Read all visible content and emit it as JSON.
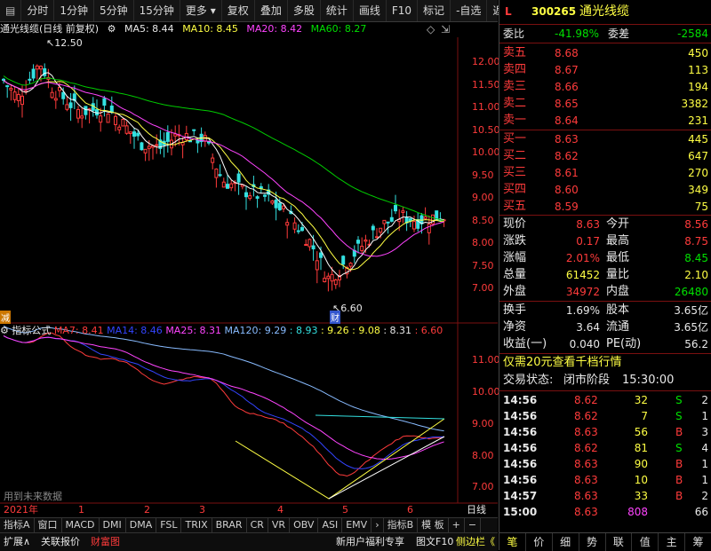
{
  "toolbar": {
    "left_items": [
      "分时",
      "1分钟",
      "5分钟",
      "15分钟",
      "更多"
    ],
    "right_items": [
      "复权",
      "叠加",
      "多股",
      "统计",
      "画线",
      "F10",
      "标记",
      "-自选",
      "返回"
    ]
  },
  "chart_header": {
    "title": "通光线缆(日线 前复权)",
    "ma5": "MA5: 8.44",
    "ma10": "MA10: 8.45",
    "ma20": "MA20: 8.42",
    "ma60": "MA60: 8.27"
  },
  "price_axis": [
    "12.00",
    "11.50",
    "11.00",
    "10.50",
    "10.00",
    "9.50",
    "9.00",
    "8.50",
    "8.00",
    "7.50",
    "7.00"
  ],
  "annotations": {
    "high_label": "12.50",
    "low_label": "6.60",
    "left_marker": "减",
    "caifu_marker": "财"
  },
  "indicator_header": {
    "name": "指标公式",
    "ma7": "MA7: 8.41",
    "ma14": "MA14: 8.46",
    "ma25": "MA25: 8.31",
    "ma120": "MA120: 9.29",
    "v1": ": 8.93",
    "v2": ": 9.26",
    "v3": ": 9.08",
    "v4": ": 8.31",
    "v5": ": 6.60"
  },
  "indicator_axis": [
    "11.00",
    "10.00",
    "9.00",
    "8.00",
    "7.00"
  ],
  "indicator_note": "用到未来数据",
  "date_axis": {
    "year": "2021年",
    "months": [
      "1",
      "2",
      "3",
      "4",
      "5",
      "6"
    ],
    "period": "日线"
  },
  "indicator_tabs": [
    "指标A",
    "窗口",
    "MACD",
    "DMI",
    "DMA",
    "FSL",
    "TRIX",
    "BRAR",
    "CR",
    "VR",
    "OBV",
    "ASI",
    "EMV",
    "指标B",
    "模 板",
    "+",
    "−"
  ],
  "bottom_left": [
    "扩展∧",
    "关联报价",
    "财富图"
  ],
  "bottom_right": [
    "新用户福利专享",
    "图文F10",
    "侧边栏《"
  ],
  "stock": {
    "flag": "L",
    "code": "300265",
    "name": "通光线缆"
  },
  "weibi": {
    "label1": "委比",
    "val1": "-41.98%",
    "label2": "委差",
    "val2": "-2584"
  },
  "sells": [
    {
      "label": "卖五",
      "price": "8.68",
      "vol": "450"
    },
    {
      "label": "卖四",
      "price": "8.67",
      "vol": "113"
    },
    {
      "label": "卖三",
      "price": "8.66",
      "vol": "194"
    },
    {
      "label": "卖二",
      "price": "8.65",
      "vol": "3382"
    },
    {
      "label": "卖一",
      "price": "8.64",
      "vol": "231"
    }
  ],
  "buys": [
    {
      "label": "买一",
      "price": "8.63",
      "vol": "445"
    },
    {
      "label": "买二",
      "price": "8.62",
      "vol": "647"
    },
    {
      "label": "买三",
      "price": "8.61",
      "vol": "270"
    },
    {
      "label": "买四",
      "price": "8.60",
      "vol": "349"
    },
    {
      "label": "买五",
      "price": "8.59",
      "vol": "75"
    }
  ],
  "quote": [
    {
      "l1": "现价",
      "v1": "8.63",
      "l2": "今开",
      "v2": "8.56"
    },
    {
      "l1": "涨跌",
      "v1": "0.17",
      "l2": "最高",
      "v2": "8.75"
    },
    {
      "l1": "涨幅",
      "v1": "2.01%",
      "l2": "最低",
      "v2": "8.45"
    },
    {
      "l1": "总量",
      "v1": "61452",
      "l2": "量比",
      "v2": "2.10"
    },
    {
      "l1": "外盘",
      "v1": "34972",
      "l2": "内盘",
      "v2": "26480"
    }
  ],
  "stats": [
    {
      "l1": "换手",
      "v1": "1.69%",
      "l2": "股本",
      "v2": "3.65亿"
    },
    {
      "l1": "净资",
      "v1": "3.64",
      "l2": "流通",
      "v2": "3.65亿"
    },
    {
      "l1": "收益(一)",
      "v1": "0.040",
      "l2": "PE(动)",
      "v2": "56.2"
    }
  ],
  "promo": "仅需20元查看千档行情",
  "status": {
    "label": "交易状态:",
    "value": "闭市阶段",
    "time": "15:30:00"
  },
  "ticks": [
    {
      "time": "14:56",
      "price": "8.62",
      "vol": "32",
      "bs": "S",
      "n": "2"
    },
    {
      "time": "14:56",
      "price": "8.62",
      "vol": "7",
      "bs": "S",
      "n": "1"
    },
    {
      "time": "14:56",
      "price": "8.63",
      "vol": "56",
      "bs": "B",
      "n": "3"
    },
    {
      "time": "14:56",
      "price": "8.62",
      "vol": "81",
      "bs": "S",
      "n": "4"
    },
    {
      "time": "14:56",
      "price": "8.63",
      "vol": "90",
      "bs": "B",
      "n": "1"
    },
    {
      "time": "14:56",
      "price": "8.63",
      "vol": "10",
      "bs": "B",
      "n": "1"
    },
    {
      "time": "14:57",
      "price": "8.63",
      "vol": "33",
      "bs": "B",
      "n": "2"
    },
    {
      "time": "15:00",
      "price": "8.63",
      "vol": "808",
      "bs": "",
      "n": "66"
    }
  ],
  "right_tabs": [
    "笔",
    "价",
    "细",
    "势",
    "联",
    "值",
    "主",
    "筹"
  ]
}
